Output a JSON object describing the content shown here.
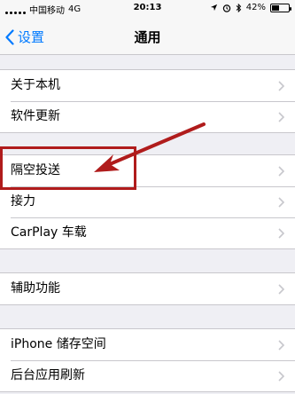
{
  "status_bar": {
    "carrier": "中国移动",
    "network": "4G",
    "time": "20:13",
    "battery": "42%"
  },
  "nav": {
    "back_label": "设置",
    "title": "通用"
  },
  "groups": [
    {
      "items": [
        "关于本机",
        "软件更新"
      ]
    },
    {
      "items": [
        "隔空投送",
        "接力",
        "CarPlay 车载"
      ]
    },
    {
      "items": [
        "辅助功能"
      ]
    },
    {
      "items": [
        "iPhone 储存空间",
        "后台应用刷新"
      ]
    }
  ],
  "colors": {
    "accent": "#007aff",
    "annotation": "#b01c1c"
  }
}
